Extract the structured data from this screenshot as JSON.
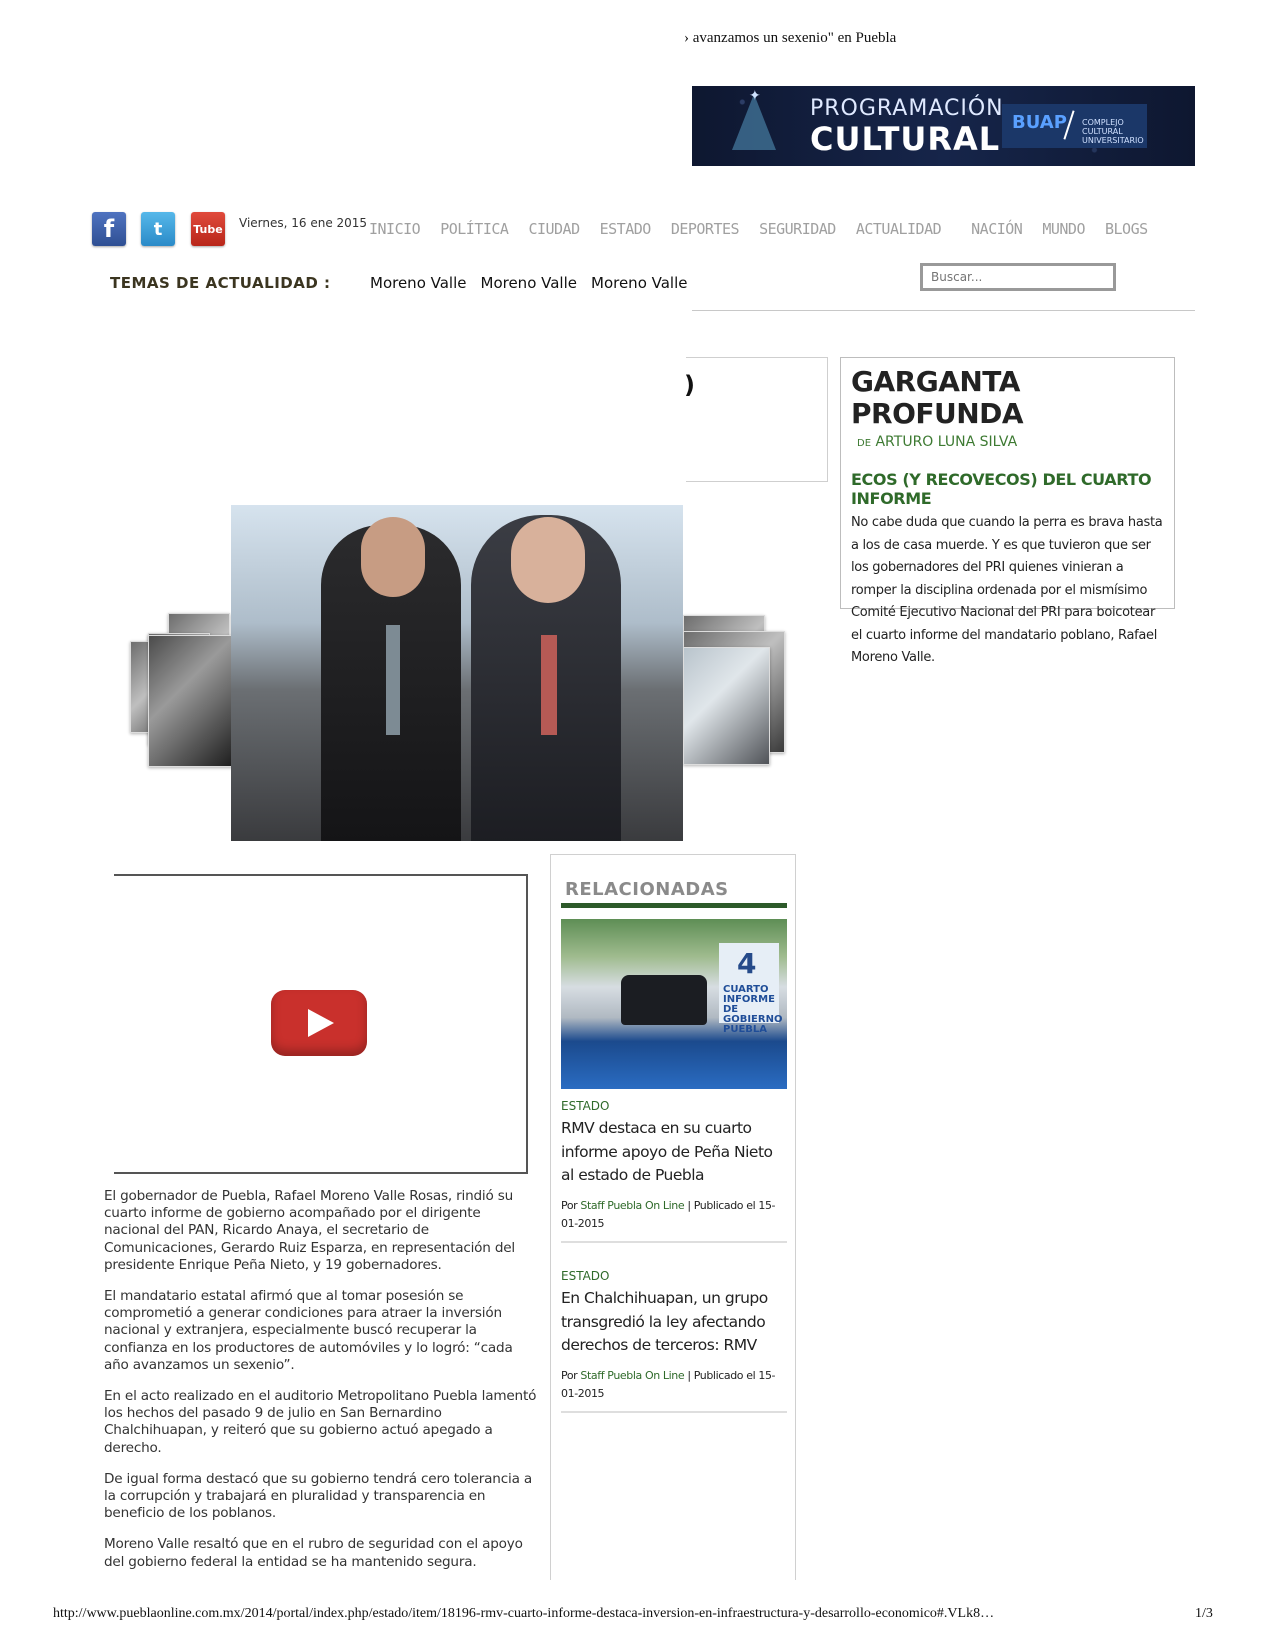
{
  "print_header": {
    "title_fragment": "› avanzamos un sexenio\" en Puebla"
  },
  "banner": {
    "line1": "PROGRAMACIÓN",
    "line2": "CULTURAL",
    "brand": "BUAP",
    "sub": "COMPLEJO CULTURAL UNIVERSITARIO"
  },
  "social": {
    "facebook": "f",
    "twitter": "t",
    "youtube": "Tube"
  },
  "date": "Viernes, 16 ene 2015",
  "nav": [
    "INICIO",
    "POLÍTICA",
    "CIUDAD",
    "ESTADO",
    "DEPORTES",
    "SEGURIDAD",
    "ACTUALIDAD",
    "NACIÓN",
    "MUNDO",
    "BLOGS"
  ],
  "topics": {
    "label": "TEMAS DE ACTUALIDAD :",
    "items": [
      "Moreno Valle",
      "Moreno Valle",
      "Moreno Valle"
    ]
  },
  "search": {
    "placeholder": "Buscar..."
  },
  "left_box": {
    "fragment": ")"
  },
  "garganta": {
    "title": "GARGANTA PROFUNDA",
    "by_prefix": "DE",
    "author": "ARTURO LUNA SILVA",
    "headline": "ECOS (Y RECOVECOS) DEL CUARTO INFORME",
    "body": "No cabe duda que cuando la perra es brava hasta a los de casa muerde. Y es que tuvieron que ser los gobernadores del PRI quienes vinieran a romper la disciplina ordenada por el mismísimo Comité Ejecutivo Nacional del PRI para boicotear el cuarto informe del mandatario poblano, Rafael Moreno Valle."
  },
  "article": {
    "paragraphs": [
      "El gobernador de Puebla, Rafael Moreno Valle Rosas,  rindió su cuarto informe de gobierno acompañado por el dirigente nacional del PAN, Ricardo Anaya, el secretario de Comunicaciones, Gerardo Ruiz Esparza, en representación del presidente Enrique Peña Nieto, y 19 gobernadores.",
      "El mandatario estatal afirmó que al tomar posesión se comprometió a generar condiciones para atraer la inversión nacional y extranjera, especialmente buscó recuperar la confianza en los productores de automóviles  y lo logró: “cada año avanzamos un sexenio”.",
      "En el acto realizado en el auditorio Metropolitano Puebla lamentó los hechos del pasado 9 de julio en San Bernardino Chalchihuapan, y reiteró que su gobierno actuó apegado a derecho.",
      "De igual forma destacó que su gobierno tendrá cero tolerancia a la corrupción y trabajará en pluralidad y transparencia en beneficio de los poblanos.",
      "Moreno Valle resaltó que en el rubro de seguridad con el apoyo del gobierno federal la entidad se ha mantenido segura."
    ]
  },
  "related": {
    "heading": "RELACIONADAS",
    "image_sign": {
      "number": "4",
      "text": "CUARTO INFORME DE GOBIERNO PUEBLA"
    },
    "items": [
      {
        "category": "ESTADO",
        "title": "RMV destaca en su cuarto informe apoyo de Peña Nieto al estado de Puebla",
        "by": "Por",
        "author": "Staff Puebla On Line",
        "published": "| Publicado el 15-01-2015"
      },
      {
        "category": "ESTADO",
        "title": "En Chalchihuapan, un grupo transgredió la ley afectando derechos de terceros: RMV",
        "by": "Por",
        "author": "Staff Puebla On Line",
        "published": "| Publicado el 15-01-2015"
      }
    ]
  },
  "footer": {
    "url": "http://www.pueblaonline.com.mx/2014/portal/index.php/estado/item/18196-rmv-cuarto-informe-destaca-inversion-en-infraestructura-y-desarrollo-economico#.VLk8…",
    "page": "1/3"
  }
}
